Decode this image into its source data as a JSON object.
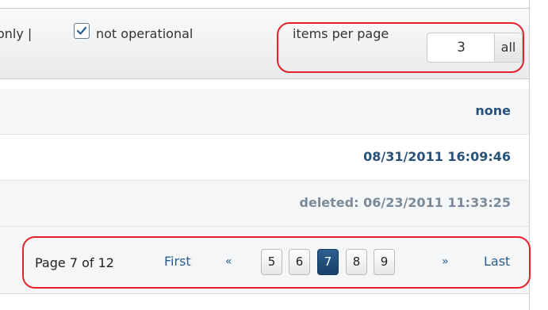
{
  "toolbar": {
    "filter_partial": "only |",
    "not_operational_label": "not operational",
    "not_operational_checked": true,
    "items_per_page_label": "items per page",
    "items_per_page_value": "3",
    "all_label": "all"
  },
  "rows": [
    {
      "value": "none"
    },
    {
      "value": "08/31/2011 16:09:46"
    },
    {
      "value": "deleted: 06/23/2011 11:33:25"
    }
  ],
  "pager": {
    "page_info": "Page 7 of 12",
    "first_label": "First",
    "prev_label": "«",
    "pages": [
      "5",
      "6",
      "7",
      "8",
      "9"
    ],
    "current_page": "7",
    "next_label": "»",
    "last_label": "Last"
  },
  "colors": {
    "accent": "#28527a",
    "highlight": "#e8202a",
    "muted": "#7b8a99"
  }
}
